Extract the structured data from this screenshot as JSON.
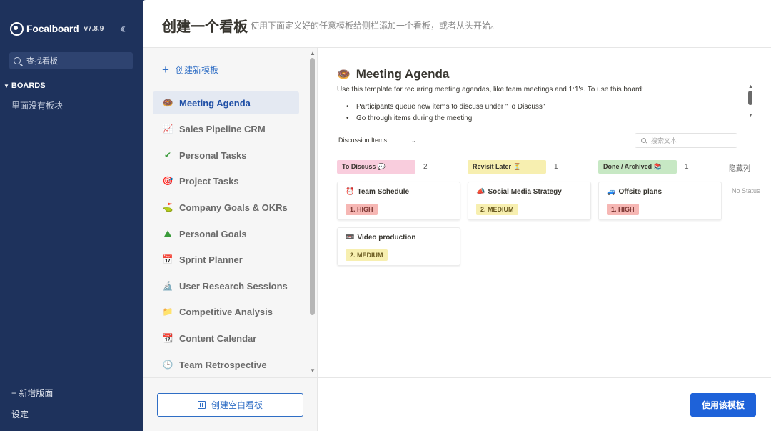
{
  "sidebar": {
    "brand": "Focalboard",
    "version": "v7.8.9",
    "search_placeholder": "查找看板",
    "boards_heading": "BOARDS",
    "no_boards": "里面没有板块",
    "add_board": "+ 新增版面",
    "settings": "设定"
  },
  "header": {
    "title": "创建一个看板",
    "subtitle": "使用下面定义好的任意模板给侧栏添加一个看板，或者从头开始。"
  },
  "templates": {
    "new_template": "创建新模板",
    "items": [
      {
        "label": "Meeting Agenda",
        "icon": "🍩"
      },
      {
        "label": "Sales Pipeline CRM",
        "icon": "📈"
      },
      {
        "label": "Personal Tasks",
        "icon": "✔"
      },
      {
        "label": "Project Tasks",
        "icon": "🎯"
      },
      {
        "label": "Company Goals & OKRs",
        "icon": "⛳"
      },
      {
        "label": "Personal Goals",
        "icon": "⛰"
      },
      {
        "label": "Sprint Planner",
        "icon": "📅"
      },
      {
        "label": "User Research Sessions",
        "icon": "🔬"
      },
      {
        "label": "Competitive Analysis",
        "icon": "📁"
      },
      {
        "label": "Content Calendar",
        "icon": "📆"
      },
      {
        "label": "Team Retrospective",
        "icon": "🕒"
      }
    ],
    "create_blank": "创建空白看板",
    "use_template": "使用该模板"
  },
  "preview": {
    "title": "Meeting Agenda",
    "icon": "🍩",
    "description": "Use this template for recurring meeting agendas, like team meetings and 1:1's. To use this board:",
    "bullets": [
      "Participants queue new items to discuss under \"To Discuss\"",
      "Go through items during the meeting"
    ],
    "view_name": "Discussion Items",
    "search_placeholder": "搜索文本",
    "more": "···",
    "hidden_columns": "隐藏列",
    "no_status": "No Status",
    "columns": [
      {
        "label": "To Discuss 💬",
        "count": "2",
        "color": "#f9cddd",
        "cards": [
          {
            "title": "Team Schedule",
            "icon": "⏰",
            "priority": "1. HIGH",
            "level": "high"
          },
          {
            "title": "Video production",
            "icon": "📼",
            "priority": "2. MEDIUM",
            "level": "medium"
          }
        ]
      },
      {
        "label": "Revisit Later ⏳",
        "count": "1",
        "color": "#f7efb0",
        "cards": [
          {
            "title": "Social Media Strategy",
            "icon": "📣",
            "priority": "2. MEDIUM",
            "level": "medium"
          }
        ]
      },
      {
        "label": "Done / Archived 📚",
        "count": "1",
        "color": "#c7e8c4",
        "cards": [
          {
            "title": "Offsite plans",
            "icon": "🚙",
            "priority": "1. HIGH",
            "level": "high"
          }
        ]
      }
    ]
  }
}
